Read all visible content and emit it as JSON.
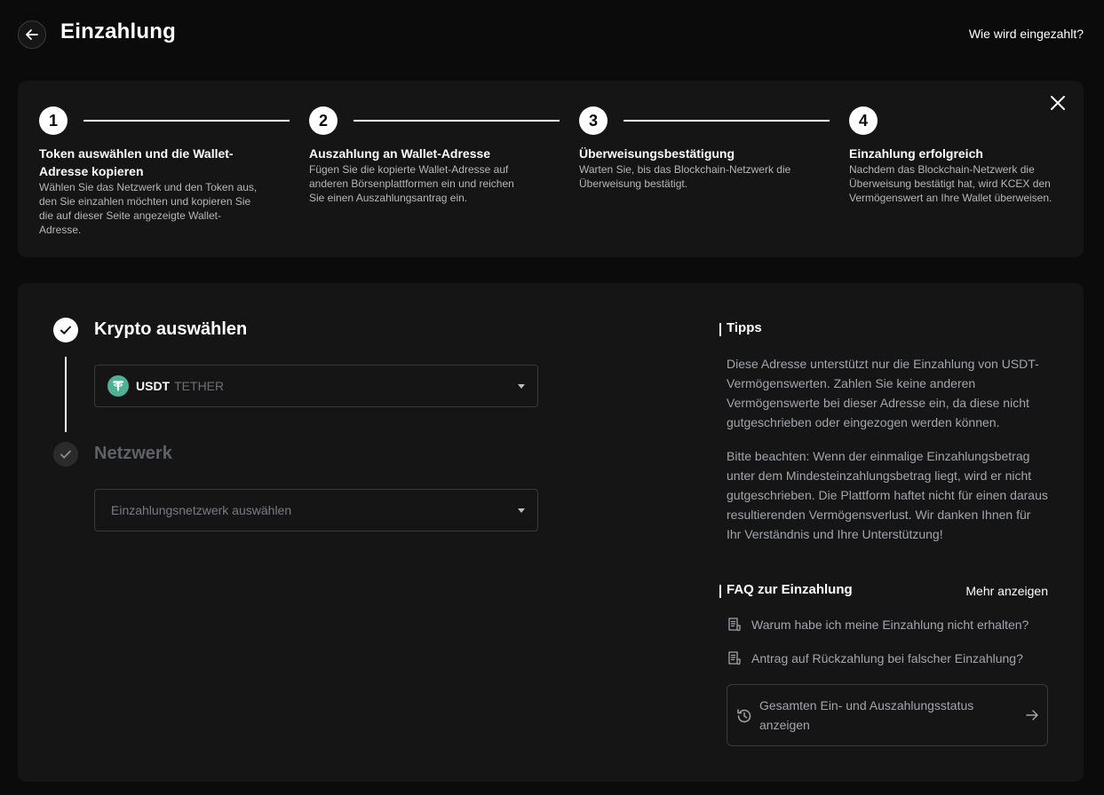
{
  "header": {
    "title": "Einzahlung",
    "help_link": "Wie wird eingezahlt?"
  },
  "steps": [
    {
      "number": "1",
      "title": "Token auswählen und die Wallet-Adresse kopieren",
      "description": "Wählen Sie das Netzwerk und den Token aus, den Sie einzahlen möchten und kopieren Sie die auf dieser Seite angezeigte Wallet-Adresse."
    },
    {
      "number": "2",
      "title": "Auszahlung an Wallet-Adresse",
      "description": "Fügen Sie die kopierte Wallet-Adresse auf anderen Börsenplattformen ein und reichen Sie einen Auszahlungsantrag ein."
    },
    {
      "number": "3",
      "title": "Überweisungsbestätigung",
      "description": "Warten Sie, bis das Blockchain-Netzwerk die Überweisung bestätigt."
    },
    {
      "number": "4",
      "title": "Einzahlung erfolgreich",
      "description": "Nachdem das Blockchain-Netzwerk die Überweisung bestätigt hat, wird KCEX den Vermögenswert an Ihre Wallet überweisen."
    }
  ],
  "form": {
    "crypto_section_title": "Krypto auswählen",
    "token_symbol": "USDT",
    "token_name": "TETHER",
    "network_section_title": "Netzwerk",
    "network_placeholder": "Einzahlungsnetzwerk auswählen"
  },
  "tips": {
    "title": "Tipps",
    "paragraph1": "Diese Adresse unterstützt nur die Einzahlung von USDT-Vermögenswerten. Zahlen Sie keine anderen Vermögenswerte bei dieser Adresse ein, da diese nicht gutgeschrieben oder eingezogen werden können.",
    "paragraph2": "Bitte beachten: Wenn der einmalige Einzahlungsbetrag unter dem Mindesteinzahlungsbetrag liegt, wird er nicht gutgeschrieben. Die Plattform haftet nicht für einen daraus resultierenden Vermögensverlust. Wir danken Ihnen für Ihr Verständnis und Ihre Unterstützung!"
  },
  "faq": {
    "title": "FAQ zur Einzahlung",
    "more_label": "Mehr anzeigen",
    "items": [
      "Warum habe ich meine Einzahlung nicht erhalten?",
      "Antrag auf Rückzahlung bei falscher Einzahlung?"
    ],
    "status_link": "Gesamten Ein- und Auszahlungsstatus anzeigen"
  },
  "icons": {
    "back": "arrow-left-icon",
    "close": "close-icon",
    "check": "check-icon",
    "token": "tether-icon",
    "caret": "caret-down-icon",
    "document": "document-icon",
    "history": "history-icon",
    "arrow": "arrow-right-icon"
  },
  "colors": {
    "background": "#0b0b0b",
    "card": "#151515",
    "tether": "#50af95",
    "muted_text": "#a3a5ab",
    "inactive": "#5f6168"
  }
}
